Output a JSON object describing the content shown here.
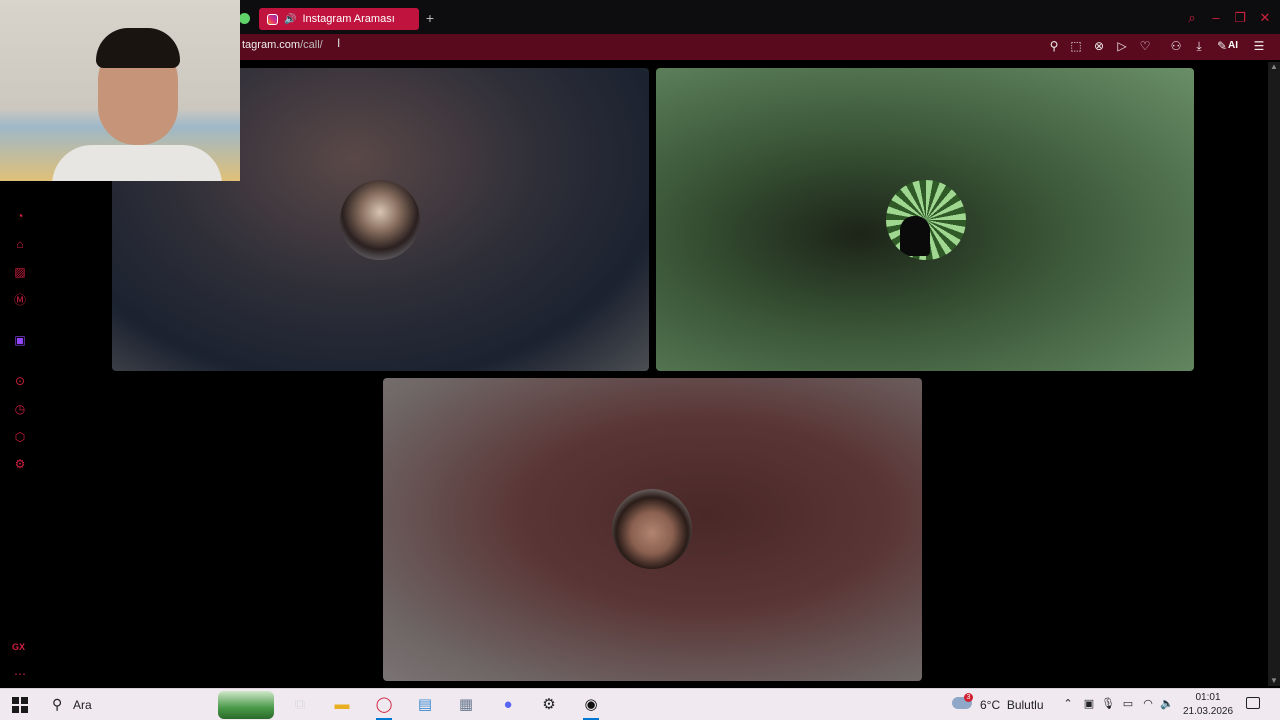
{
  "browser": {
    "tab": {
      "title": "Instagram Araması"
    },
    "url": {
      "host": "tagram.com",
      "path": "/call/"
    },
    "toolbar": {
      "ai_label": "AI"
    },
    "sidebar": {
      "gx_label": "GX"
    }
  },
  "call": {
    "participants": [
      {
        "avatar": "participant-avatar-woman"
      },
      {
        "avatar": "participant-avatar-cat-window"
      },
      {
        "avatar": "participant-avatar-man"
      }
    ]
  },
  "taskbar": {
    "search_label": "Ara",
    "weather": {
      "temp": "6°C",
      "condition": "Bulutlu",
      "badge": "3"
    },
    "clock": {
      "time": "01:01",
      "date": "21.03.2026"
    }
  },
  "colors": {
    "accent": "#c0143f",
    "address_bar": "#5c0a1e",
    "sidebar_icon": "#d0203e",
    "taskbar": "#f0eaf0"
  }
}
